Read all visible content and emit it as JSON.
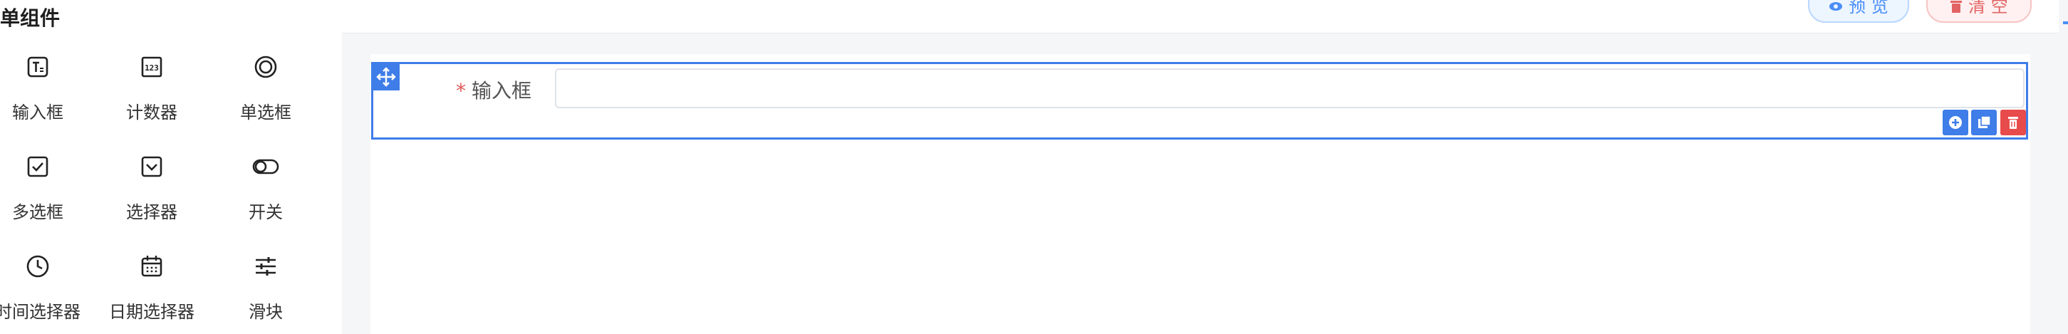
{
  "sidebar": {
    "section_title": "单组件",
    "components": [
      {
        "label": "输入框",
        "icon": "text-input-icon"
      },
      {
        "label": "计数器",
        "icon": "counter-icon"
      },
      {
        "label": "单选框",
        "icon": "radio-icon"
      },
      {
        "label": "多选框",
        "icon": "checkbox-icon"
      },
      {
        "label": "选择器",
        "icon": "select-icon"
      },
      {
        "label": "开关",
        "icon": "switch-icon"
      },
      {
        "label": "时间选择器",
        "icon": "time-picker-icon"
      },
      {
        "label": "日期选择器",
        "icon": "date-picker-icon"
      },
      {
        "label": "滑块",
        "icon": "slider-icon"
      }
    ]
  },
  "toolbar": {
    "preview_label": "预 览",
    "clear_label": "清 空",
    "preview_icon": "eye-icon",
    "clear_icon": "trash-icon"
  },
  "form": {
    "field_label": "输入框",
    "required_mark": "*",
    "input_value": "",
    "input_placeholder": ""
  },
  "field_actions": {
    "add_icon": "add-circle-icon",
    "copy_icon": "copy-icon",
    "delete_icon": "trash-icon"
  },
  "colors": {
    "primary": "#3f7de8",
    "danger": "#e84b4b",
    "required": "#e25a5a",
    "canvas_bg": "#f5f6f8"
  }
}
